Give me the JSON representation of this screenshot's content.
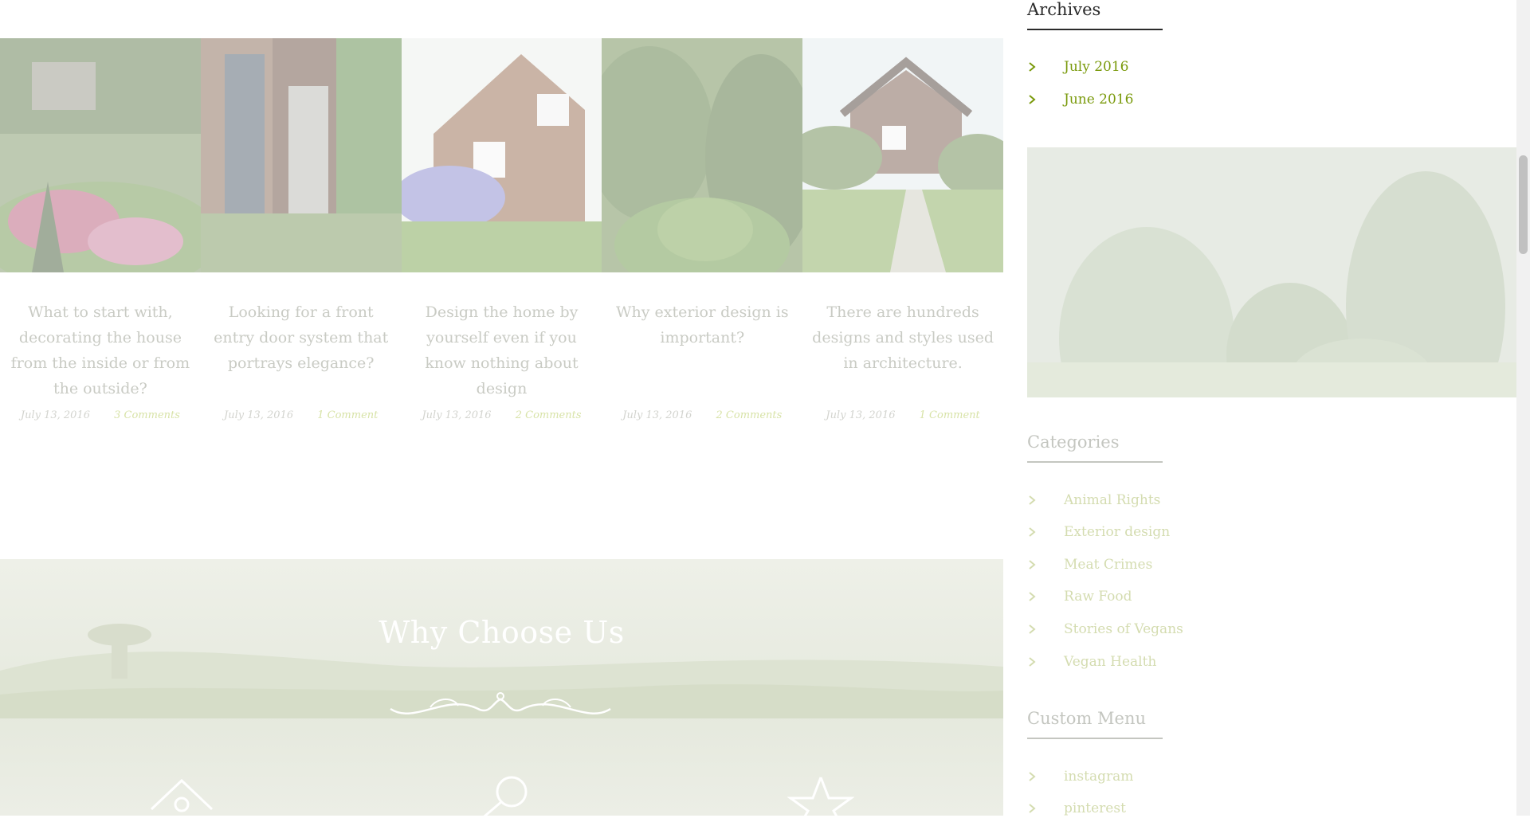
{
  "posts": [
    {
      "title": "What to start with, decorating the house from the inside or from the outside?",
      "date": "July 13, 2016",
      "comments": "3 Comments"
    },
    {
      "title": "Looking for a front entry door system that portrays elegance?",
      "date": "July 13, 2016",
      "comments": "1 Comment"
    },
    {
      "title": "Design the home by yourself even if you know nothing about design",
      "date": "July 13, 2016",
      "comments": "2 Comments"
    },
    {
      "title": "Why exterior design is important?",
      "date": "July 13, 2016",
      "comments": "2 Comments"
    },
    {
      "title": "There are hundreds designs and styles used in architecture.",
      "date": "July 13, 2016",
      "comments": "1 Comment"
    }
  ],
  "why_choose_us": {
    "title": "Why Choose Us",
    "icons": [
      "house-icon",
      "tool-icon",
      "star-icon"
    ]
  },
  "sidebar": {
    "archives": {
      "title": "Archives",
      "items": [
        "July 2016",
        "June 2016"
      ]
    },
    "categories": {
      "title": "Categories",
      "items": [
        "Animal Rights",
        "Exterior design",
        "Meat Crimes",
        "Raw Food",
        "Stories of Vegans",
        "Vegan Health"
      ]
    },
    "custom_menu": {
      "title": "Custom Menu",
      "items": [
        "instagram",
        "pinterest"
      ]
    }
  },
  "colors": {
    "accent": "#7a9a0c",
    "heading": "#2a2a2a"
  }
}
